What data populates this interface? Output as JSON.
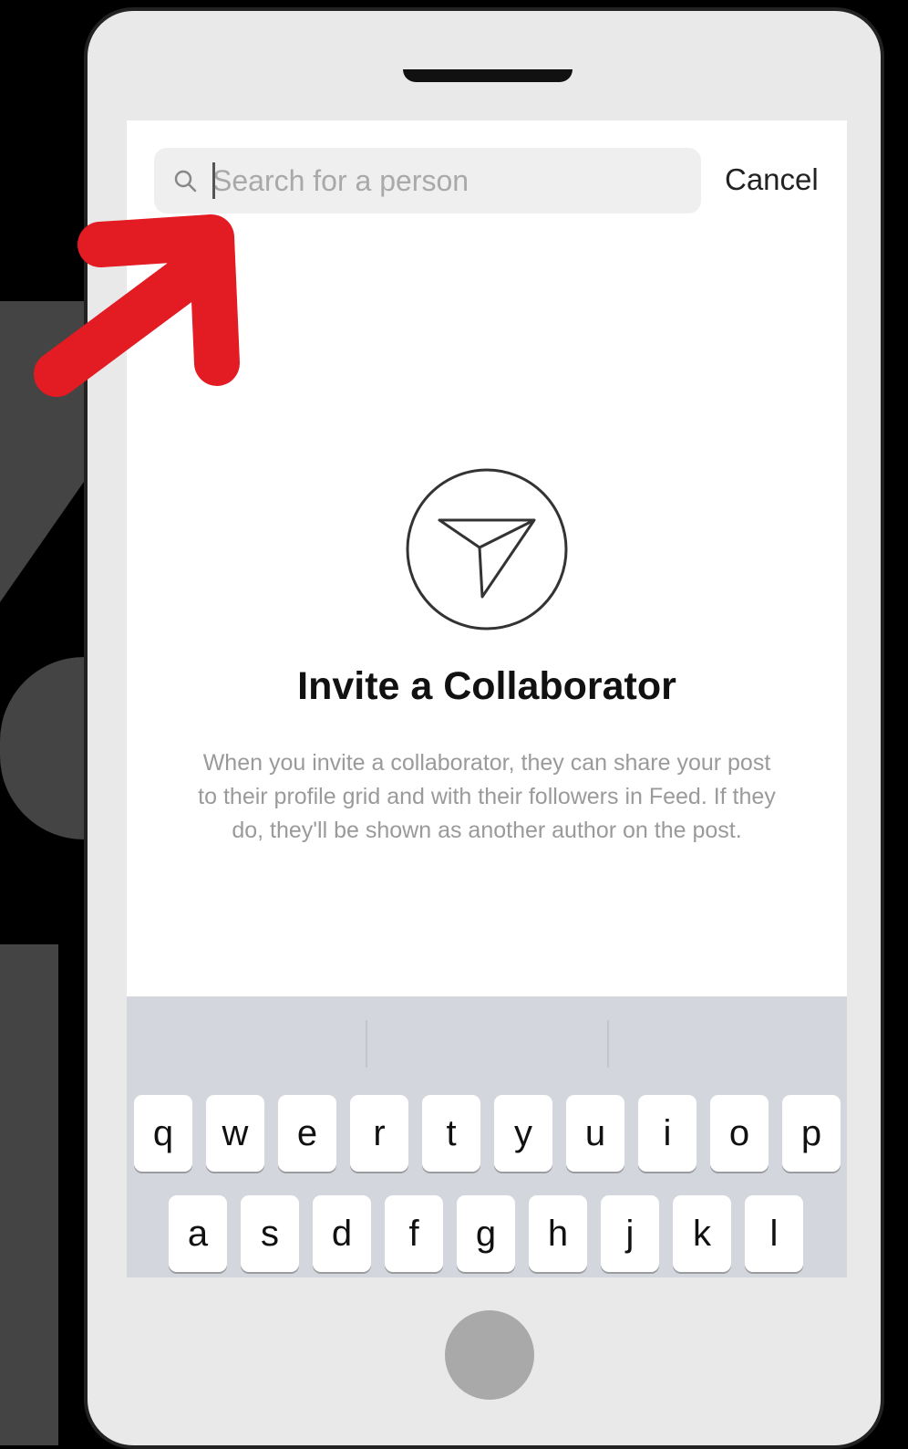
{
  "search": {
    "placeholder": "Search for a person",
    "cancel_label": "Cancel"
  },
  "invite": {
    "title": "Invite a Collaborator",
    "description": "When you invite a collaborator, they can share your post to their profile grid and with their followers in Feed. If they do, they'll be shown as another author on the post."
  },
  "keyboard": {
    "row1": [
      "q",
      "w",
      "e",
      "r",
      "t",
      "y",
      "u",
      "i",
      "o",
      "p"
    ],
    "row2": [
      "a",
      "s",
      "d",
      "f",
      "g",
      "h",
      "j",
      "k",
      "l"
    ]
  },
  "colors": {
    "annotation_arrow": "#e31b23",
    "keyboard_bg": "#d3d6dc",
    "phone_body": "#e9e9e9"
  },
  "icons": {
    "search": "search-icon",
    "invite": "paper-plane-icon",
    "annotation": "red-arrow-icon"
  }
}
